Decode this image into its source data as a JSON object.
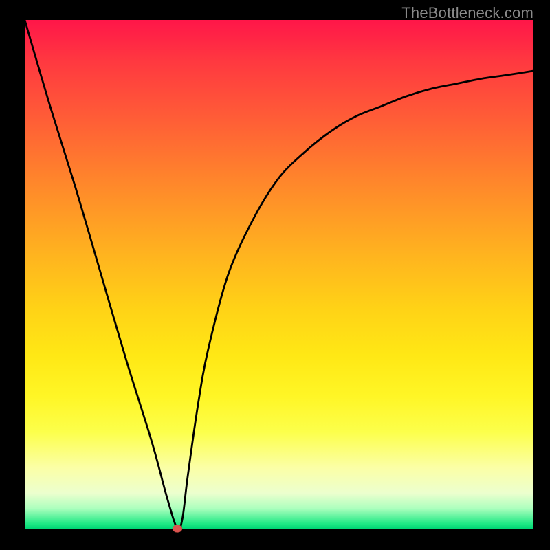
{
  "watermark": "TheBottleneck.com",
  "chart_data": {
    "type": "line",
    "title": "",
    "xlabel": "",
    "ylabel": "",
    "xlim": [
      0,
      100
    ],
    "ylim": [
      0,
      100
    ],
    "background_gradient": {
      "direction": "vertical",
      "top_color": "#ff1649",
      "bottom_color": "#00d574"
    },
    "series": [
      {
        "name": "bottleneck-curve",
        "x": [
          0,
          5,
          10,
          15,
          20,
          25,
          28,
          30,
          31,
          32,
          34,
          36,
          40,
          45,
          50,
          55,
          60,
          65,
          70,
          75,
          80,
          85,
          90,
          95,
          100
        ],
        "values": [
          100,
          83,
          67,
          50,
          33,
          17,
          6,
          0,
          2,
          10,
          24,
          35,
          50,
          61,
          69,
          74,
          78,
          81,
          83,
          85,
          86.5,
          87.5,
          88.5,
          89.2,
          90
        ]
      }
    ],
    "marker": {
      "name": "optimal-point",
      "x": 30,
      "y": 0,
      "color": "#d9534f"
    }
  }
}
